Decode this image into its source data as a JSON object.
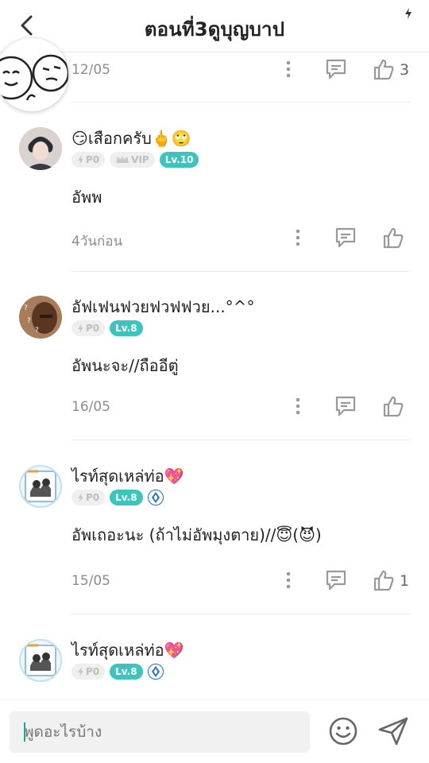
{
  "header": {
    "title": "ตอนที่3ดูบุญบาป"
  },
  "comments": [
    {
      "date": "12/05",
      "likes": "3"
    },
    {
      "name": "😏เสือกครับ🖕🙄",
      "badge_p": "P0",
      "badge_vip": "VIP",
      "badge_lv": "Lv.10",
      "text": "อัพพ",
      "date": "4วันก่อน",
      "likes": ""
    },
    {
      "name": "อัฟเฟนฟวยฟวฟฟวย...°^°",
      "badge_p": "P0",
      "badge_lv": "Lv.8",
      "text": "อัพนะจะ//ถืออีตู่",
      "date": "16/05",
      "likes": ""
    },
    {
      "name": "ไรท์สุดเหล่ท่อ💖",
      "badge_p": "P0",
      "badge_lv": "Lv.8",
      "text": "อัพเถอะนะ (ถ้าไม่อัพมุงตาย)//😇(😈)",
      "date": "15/05",
      "likes": "1"
    },
    {
      "name": "ไรท์สุดเหล่ท่อ💖",
      "badge_p": "P0",
      "badge_lv": "Lv.8"
    }
  ],
  "composer": {
    "placeholder": "พูดอะไรบ้าง"
  },
  "colors": {
    "accent": "#3cc5bd",
    "text": "#222222",
    "muted": "#8c8c8c"
  },
  "icons": [
    "back-arrow-icon",
    "flash-icon",
    "more-icon",
    "reply-icon",
    "like-icon",
    "bolt-icon",
    "crown-icon",
    "gem-icon",
    "emoji-icon",
    "send-icon"
  ]
}
